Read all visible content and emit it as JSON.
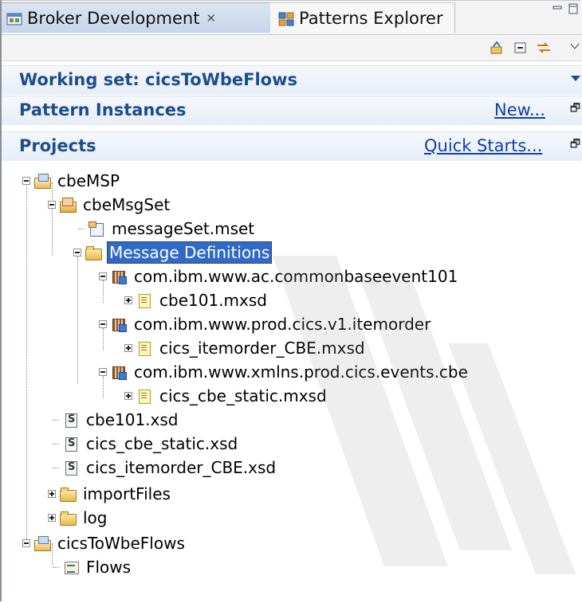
{
  "tabs": [
    {
      "label": "Broker Development",
      "close": "✕",
      "active": true
    },
    {
      "label": "Patterns Explorer",
      "active": false
    }
  ],
  "sections": {
    "working_set": "Working set: cicsToWbeFlows",
    "pattern_instances": {
      "title": "Pattern Instances",
      "link": "New..."
    },
    "projects": {
      "title": "Projects",
      "link": "Quick Starts..."
    }
  },
  "tree": [
    {
      "label": "cbeMSP",
      "icon": "project-icon"
    },
    {
      "label": "cbeMsgSet",
      "icon": "message-set-project-icon"
    },
    {
      "label": "messageSet.mset",
      "icon": "message-set-file-icon"
    },
    {
      "label": "Message Definitions",
      "icon": "message-definitions-folder-icon",
      "selected": true
    },
    {
      "label": "com.ibm.www.ac.commonbaseevent101",
      "icon": "namespace-icon"
    },
    {
      "label": "cbe101.mxsd",
      "icon": "mxsd-file-icon"
    },
    {
      "label": "com.ibm.www.prod.cics.v1.itemorder",
      "icon": "namespace-icon"
    },
    {
      "label": "cics_itemorder_CBE.mxsd",
      "icon": "mxsd-file-icon"
    },
    {
      "label": "com.ibm.www.xmlns.prod.cics.events.cbe",
      "icon": "namespace-icon"
    },
    {
      "label": "cics_cbe_static.mxsd",
      "icon": "mxsd-file-icon"
    },
    {
      "label": "cbe101.xsd",
      "icon": "xsd-file-icon"
    },
    {
      "label": "cics_cbe_static.xsd",
      "icon": "xsd-file-icon"
    },
    {
      "label": "cics_itemorder_CBE.xsd",
      "icon": "xsd-file-icon"
    },
    {
      "label": "importFiles",
      "icon": "folder-icon"
    },
    {
      "label": "log",
      "icon": "folder-icon"
    },
    {
      "label": "cicsToWbeFlows",
      "icon": "project-icon"
    },
    {
      "label": "Flows",
      "icon": "flows-icon"
    }
  ],
  "colors": {
    "section_title": "#1e4d8e",
    "link": "#1240a8",
    "selection": "#3169c6"
  }
}
